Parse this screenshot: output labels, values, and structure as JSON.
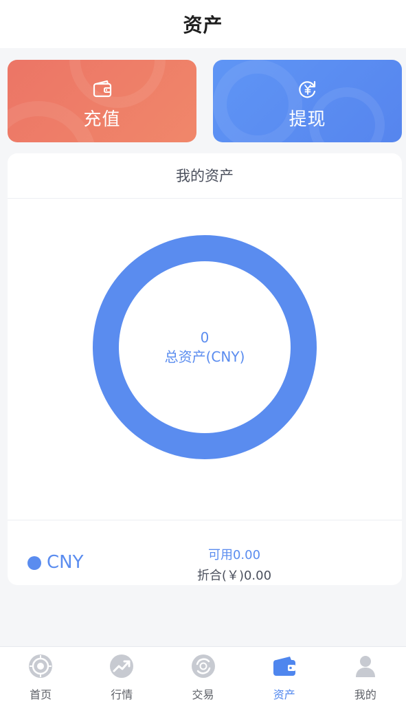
{
  "header": {
    "title": "资产"
  },
  "actions": {
    "recharge_label": "充值",
    "withdraw_label": "提现",
    "recharge_color": "#ec7566",
    "withdraw_color": "#5a8cef"
  },
  "assets": {
    "panel_title": "我的资产",
    "total_value": "0",
    "total_label": "总资产(CNY)",
    "currencies": [
      {
        "name": "CNY",
        "available": "可用0.00",
        "converted": "折合(￥)0.00",
        "color": "#5a8cef"
      }
    ]
  },
  "nav": {
    "items": [
      {
        "label": "首页",
        "icon": "home-target-icon"
      },
      {
        "label": "行情",
        "icon": "market-trend-icon"
      },
      {
        "label": "交易",
        "icon": "trade-exchange-icon"
      },
      {
        "label": "资产",
        "icon": "wallet-icon",
        "active": true
      },
      {
        "label": "我的",
        "icon": "user-icon"
      }
    ],
    "active_color": "#4f86ee",
    "inactive_color": "#c7cad1"
  }
}
